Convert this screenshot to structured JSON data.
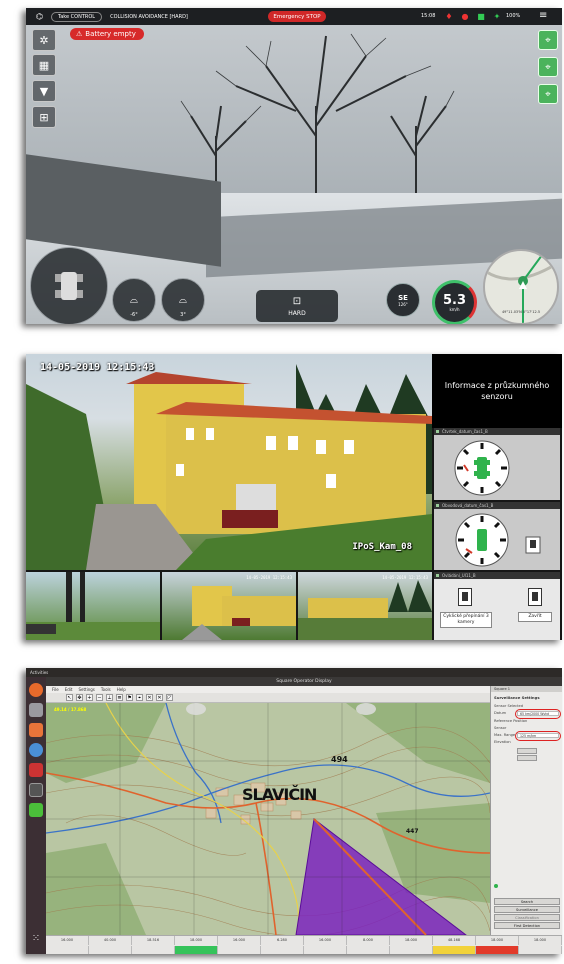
{
  "hud": {
    "take_control": "Take CONTROL",
    "collision_mode": "COLLISION AVOIDANCE [HARD]",
    "emergency_stop": "Emergency STOP",
    "time": "15:08",
    "battery_level": "100%",
    "battery_alert": "Battery empty",
    "left_buttons": [
      "target-icon",
      "grid-icon",
      "down-arrow-icon",
      "multi-view-icon"
    ],
    "waypoint_buttons": 3,
    "roll_value": "-6°",
    "pitch_value": "3°",
    "mode": "HARD",
    "heading_dir": "SE",
    "heading_deg": "126°",
    "speed": "5.3",
    "speed_unit": "km/h",
    "coords": "49°11.03'N 0°17'12.5"
  },
  "surveillance": {
    "timestamp": "14-05-2019 12:15:43",
    "camera_name": "IPoS_Kam_08",
    "info_title": "Informace z průzkumného senzoru",
    "sensor_1_title": "Čtvrtek_datum_čas1_B",
    "sensor_2_title": "Obvodová_datum_čas1_B",
    "sensor_3_title": "Ovládání_UI11_B",
    "cycle_label": "Cyklické přepínání 3 kamery",
    "close_label": "Zavřít",
    "thumb_time_2": "14-05-2019 12:15:43",
    "thumb_time_3": "14-05-2019 12:15:43",
    "badge_colors": {
      "green": "#2fb34c",
      "red": "#d33a2a"
    }
  },
  "map_app": {
    "activities": "Activities",
    "window_title": "Square Operator Display",
    "menu": [
      "File",
      "Edit",
      "Settings",
      "Tools",
      "Help"
    ],
    "place_label": "SLAVIČIN",
    "elevation_1": "494",
    "elevation_2": "447",
    "side_title": "Square 1",
    "side_section": "Surveillance Settings",
    "side_labels": [
      "Sensor Selected",
      "Datum",
      "Reference Position",
      "Sensor",
      "Max. Range",
      "Elevation"
    ],
    "side_values": [
      "65 km/2000 Wshd",
      "125 m/km"
    ],
    "side_buttons": [
      "Search",
      "Surveillance",
      "Classification",
      "First Detection"
    ],
    "coordinate_readout": "49.14 / 17.868",
    "statusbar_cells": [
      "16.000",
      "40.000",
      "18.516",
      "18.000",
      "16.000",
      "6.280",
      "16.000",
      "8.000",
      "18.000",
      "48.168",
      "18.000",
      "18.000"
    ],
    "highlight_color": "#7a1fc0"
  }
}
